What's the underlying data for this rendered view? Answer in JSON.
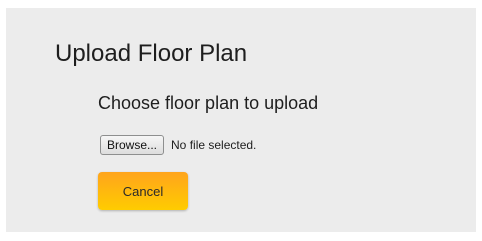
{
  "dialog": {
    "title": "Upload Floor Plan",
    "subtitle": "Choose floor plan to upload"
  },
  "file_input": {
    "browse_label": "Browse...",
    "status_text": "No file selected."
  },
  "actions": {
    "cancel_label": "Cancel"
  },
  "colors": {
    "panel_background": "#ececec",
    "cancel_button_top": "#ffa41c",
    "cancel_button_bottom": "#ffcc00"
  }
}
